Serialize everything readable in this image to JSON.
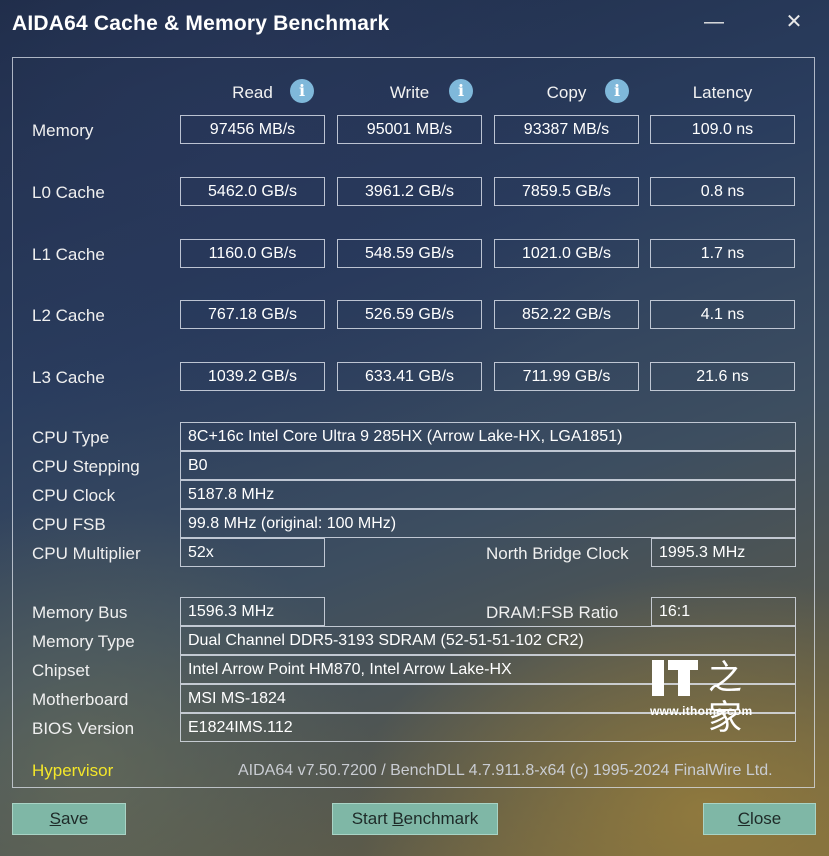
{
  "window": {
    "title": "AIDA64 Cache & Memory Benchmark",
    "minimize_glyph": "—",
    "close_glyph": "✕"
  },
  "columns": {
    "read": "Read",
    "write": "Write",
    "copy": "Copy",
    "latency": "Latency",
    "info_glyph": "i"
  },
  "bench": [
    {
      "label": "Memory",
      "read": "97456 MB/s",
      "write": "95001 MB/s",
      "copy": "93387 MB/s",
      "latency": "109.0 ns"
    },
    {
      "label": "L0 Cache",
      "read": "5462.0 GB/s",
      "write": "3961.2 GB/s",
      "copy": "7859.5 GB/s",
      "latency": "0.8 ns"
    },
    {
      "label": "L1 Cache",
      "read": "1160.0 GB/s",
      "write": "548.59 GB/s",
      "copy": "1021.0 GB/s",
      "latency": "1.7 ns"
    },
    {
      "label": "L2 Cache",
      "read": "767.18 GB/s",
      "write": "526.59 GB/s",
      "copy": "852.22 GB/s",
      "latency": "4.1 ns"
    },
    {
      "label": "L3 Cache",
      "read": "1039.2 GB/s",
      "write": "633.41 GB/s",
      "copy": "711.99 GB/s",
      "latency": "21.6 ns"
    }
  ],
  "info": {
    "cpu_type": {
      "label": "CPU Type",
      "value": "8C+16c Intel Core Ultra 9 285HX  (Arrow Lake-HX, LGA1851)"
    },
    "cpu_stepping": {
      "label": "CPU Stepping",
      "value": "B0"
    },
    "cpu_clock": {
      "label": "CPU Clock",
      "value": "5187.8 MHz"
    },
    "cpu_fsb": {
      "label": "CPU FSB",
      "value": "99.8 MHz  (original: 100 MHz)"
    },
    "cpu_multiplier": {
      "label": "CPU Multiplier",
      "value": "52x"
    },
    "north_bridge": {
      "label": "North Bridge Clock",
      "value": "1995.3 MHz"
    },
    "memory_bus": {
      "label": "Memory Bus",
      "value": "1596.3 MHz"
    },
    "dram_fsb": {
      "label": "DRAM:FSB Ratio",
      "value": "16:1"
    },
    "memory_type": {
      "label": "Memory Type",
      "value": "Dual Channel DDR5-3193 SDRAM  (52-51-51-102 CR2)"
    },
    "chipset": {
      "label": "Chipset",
      "value": "Intel Arrow Point HM870, Intel Arrow Lake-HX"
    },
    "motherboard": {
      "label": "Motherboard",
      "value": "MSI MS-1824"
    },
    "bios": {
      "label": "BIOS Version",
      "value": "E1824IMS.112"
    }
  },
  "hypervisor": "Hypervisor",
  "footer": "AIDA64 v7.50.7200 / BenchDLL 4.7.911.8-x64  (c) 1995-2024 FinalWire Ltd.",
  "buttons": {
    "save_key": "S",
    "save_rest": "ave",
    "start_pre": "Start ",
    "start_key": "B",
    "start_rest": "enchmark",
    "close_key": "C",
    "close_rest": "lose"
  },
  "watermark": {
    "glyph": "之家",
    "url": "www.ithome.com"
  }
}
